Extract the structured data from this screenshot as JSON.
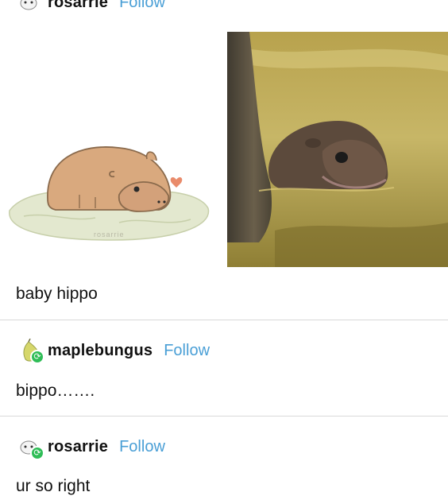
{
  "top_post": {
    "username": "rosarrie",
    "follow_label": "Follow"
  },
  "images": {
    "left": {
      "description_icon": "illustrated-baby-hippo",
      "signature": "rosarrie"
    },
    "right": {
      "description_icon": "photo-baby-pygmy-hippo"
    }
  },
  "caption": "baby hippo",
  "reblogs": [
    {
      "username": "maplebungus",
      "follow_label": "Follow",
      "comment": "bippo……."
    },
    {
      "username": "rosarrie",
      "follow_label": "Follow",
      "comment": "ur so right"
    }
  ],
  "colors": {
    "follow_link": "#4a9fd6",
    "reblog_badge": "#2fbd57",
    "divider": "#d9d9d9"
  }
}
